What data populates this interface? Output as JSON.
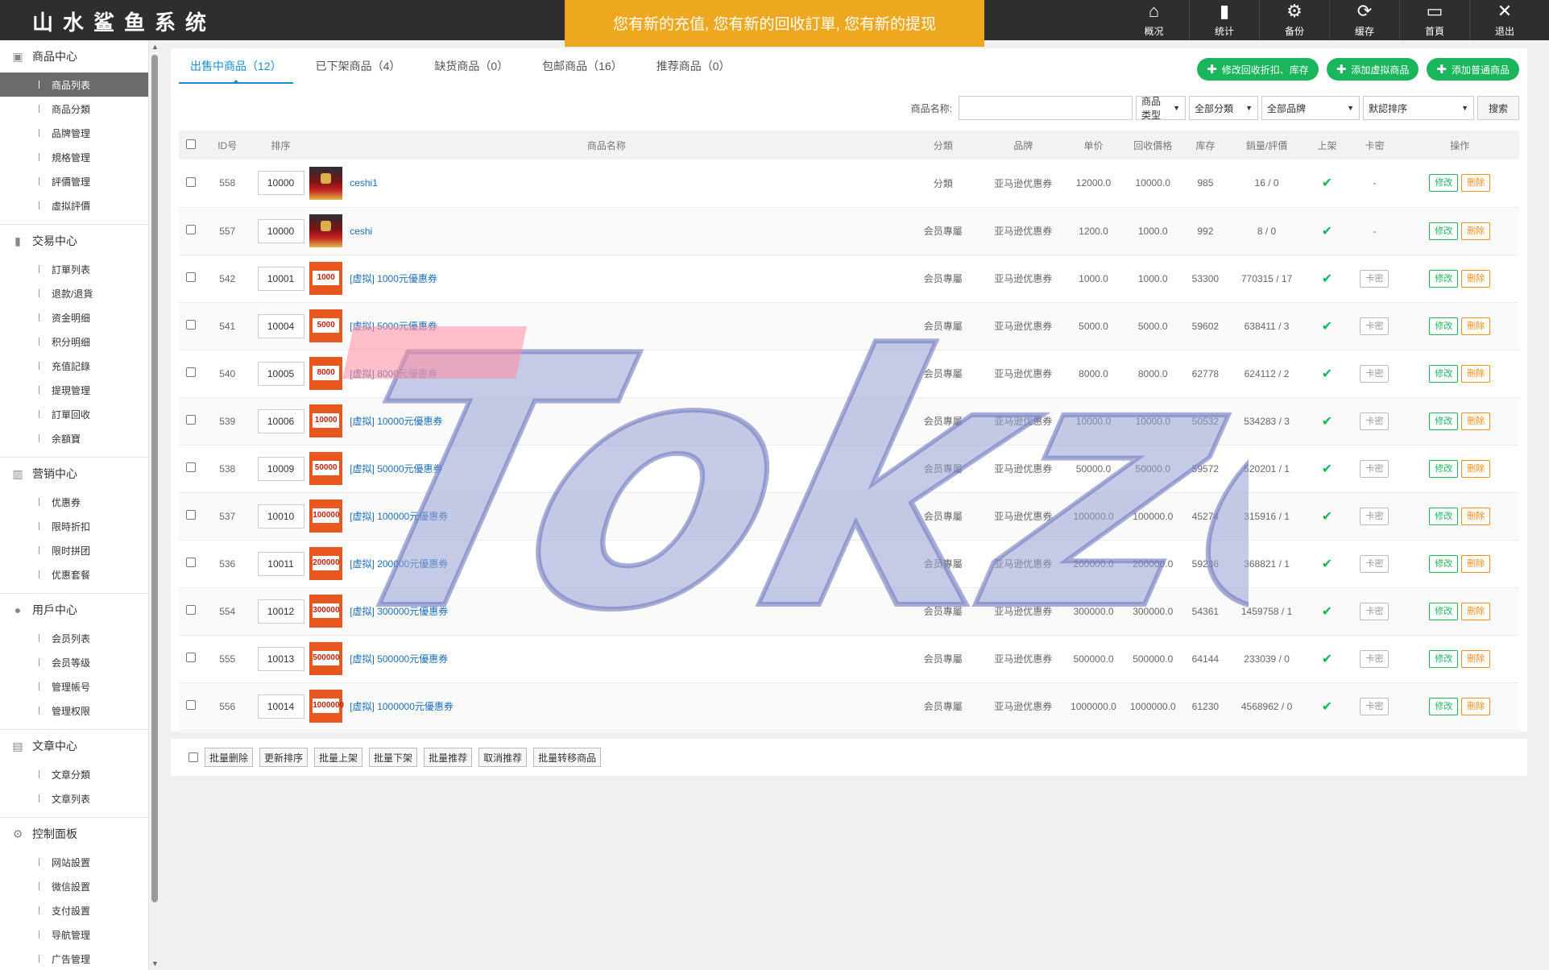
{
  "app": {
    "title": "山水鲨鱼系统"
  },
  "notice": {
    "text": "您有新的充值, 您有新的回收訂單, 您有新的提现"
  },
  "topnav": [
    {
      "label": "概况",
      "icon": "home-icon",
      "glyph": "⌂"
    },
    {
      "label": "统计",
      "icon": "bar-chart-icon",
      "glyph": "▮"
    },
    {
      "label": "备份",
      "icon": "gear-icon",
      "glyph": "⚙"
    },
    {
      "label": "缓存",
      "icon": "refresh-icon",
      "glyph": "⟳"
    },
    {
      "label": "首頁",
      "icon": "monitor-icon",
      "glyph": "▭"
    },
    {
      "label": "退出",
      "icon": "close-icon",
      "glyph": "✕"
    }
  ],
  "sidebar": [
    {
      "title": "商品中心",
      "icon": "box-icon",
      "glyph": "▣",
      "items": [
        "商品列表",
        "商品分類",
        "品牌管理",
        "規格管理",
        "評價管理",
        "虛拟評價"
      ]
    },
    {
      "title": "交易中心",
      "icon": "chart-icon",
      "glyph": "▮",
      "items": [
        "訂單列表",
        "退款/退貨",
        "资金明细",
        "积分明细",
        "充值記錄",
        "提現管理",
        "訂單回收",
        "余額寶"
      ]
    },
    {
      "title": "营销中心",
      "icon": "marketing-icon",
      "glyph": "▥",
      "items": [
        "优惠券",
        "限時折扣",
        "限时拼团",
        "优惠套餐"
      ]
    },
    {
      "title": "用戶中心",
      "icon": "user-icon",
      "glyph": "●",
      "items": [
        "会员列表",
        "会员等级",
        "管理帳号",
        "管理权限"
      ]
    },
    {
      "title": "文章中心",
      "icon": "document-icon",
      "glyph": "▤",
      "items": [
        "文章分類",
        "文章列表"
      ]
    },
    {
      "title": "控制面板",
      "icon": "settings-icon",
      "glyph": "⚙",
      "items": [
        "网站設置",
        "微信設置",
        "支付設置",
        "导航管理",
        "广告管理"
      ]
    }
  ],
  "tabs": [
    "出售中商品（12）",
    "已下架商品（4）",
    "缺货商品（0）",
    "包邮商品（16）",
    "推荐商品（0）"
  ],
  "actions": [
    "修改回收折扣、库存",
    "添加虚拟商品",
    "添加普通商品"
  ],
  "search": {
    "label": "商品名称:",
    "type_select": "商品类型",
    "category_select": "全部分類",
    "brand_select": "全部品牌",
    "sort_select": "默認排序",
    "button": "搜索"
  },
  "table": {
    "headers": [
      "ID号",
      "排序",
      "商品名称",
      "分類",
      "品牌",
      "单价",
      "回收價格",
      "库存",
      "銷量/評價",
      "上架",
      "卡密",
      "操作"
    ],
    "rows": [
      {
        "id": "558",
        "sort": "10000",
        "name": "ceshi1",
        "thumb": "hero",
        "category": "分類",
        "brand": "亚马逊优惠券",
        "price": "12000.0",
        "recycle": "10000.0",
        "stock": "985",
        "sales": "16 / 0",
        "card": "-"
      },
      {
        "id": "557",
        "sort": "10000",
        "name": "ceshi",
        "thumb": "hero",
        "category": "会员專屬",
        "brand": "亚马逊优惠券",
        "price": "1200.0",
        "recycle": "1000.0",
        "stock": "992",
        "sales": "8 / 0",
        "card": "-"
      },
      {
        "id": "542",
        "sort": "10001",
        "name": "[虚拟] 1000元優惠券",
        "thumb": "1000",
        "category": "会员專屬",
        "brand": "亚马逊优惠券",
        "price": "1000.0",
        "recycle": "1000.0",
        "stock": "53300",
        "sales": "770315 / 17",
        "card": "卡密"
      },
      {
        "id": "541",
        "sort": "10004",
        "name": "[虚拟] 5000元優惠券",
        "thumb": "5000",
        "category": "会员專屬",
        "brand": "亚马逊优惠券",
        "price": "5000.0",
        "recycle": "5000.0",
        "stock": "59602",
        "sales": "638411 / 3",
        "card": "卡密"
      },
      {
        "id": "540",
        "sort": "10005",
        "name": "[虚拟] 8000元優惠券",
        "thumb": "8000",
        "category": "会员專屬",
        "brand": "亚马逊优惠券",
        "price": "8000.0",
        "recycle": "8000.0",
        "stock": "62778",
        "sales": "624112 / 2",
        "card": "卡密"
      },
      {
        "id": "539",
        "sort": "10006",
        "name": "[虚拟] 10000元優惠券",
        "thumb": "10000",
        "category": "会员專屬",
        "brand": "亚马逊优惠券",
        "price": "10000.0",
        "recycle": "10000.0",
        "stock": "50532",
        "sales": "534283 / 3",
        "card": "卡密"
      },
      {
        "id": "538",
        "sort": "10009",
        "name": "[虚拟] 50000元優惠券",
        "thumb": "50000",
        "category": "会员專屬",
        "brand": "亚马逊优惠券",
        "price": "50000.0",
        "recycle": "50000.0",
        "stock": "59572",
        "sales": "520201 / 1",
        "card": "卡密"
      },
      {
        "id": "537",
        "sort": "10010",
        "name": "[虚拟] 100000元優惠券",
        "thumb": "100000",
        "category": "会员專屬",
        "brand": "亚马逊优惠券",
        "price": "100000.0",
        "recycle": "100000.0",
        "stock": "45274",
        "sales": "315916 / 1",
        "card": "卡密"
      },
      {
        "id": "536",
        "sort": "10011",
        "name": "[虚拟] 200000元優惠券",
        "thumb": "200000",
        "category": "会员專屬",
        "brand": "亚马逊优惠券",
        "price": "200000.0",
        "recycle": "200000.0",
        "stock": "59236",
        "sales": "368821 / 1",
        "card": "卡密"
      },
      {
        "id": "554",
        "sort": "10012",
        "name": "[虚拟] 300000元優惠券",
        "thumb": "300000",
        "category": "会员專屬",
        "brand": "亚马逊优惠券",
        "price": "300000.0",
        "recycle": "300000.0",
        "stock": "54361",
        "sales": "1459758 / 1",
        "card": "卡密"
      },
      {
        "id": "555",
        "sort": "10013",
        "name": "[虚拟] 500000元優惠券",
        "thumb": "500000",
        "category": "会员專屬",
        "brand": "亚马逊优惠券",
        "price": "500000.0",
        "recycle": "500000.0",
        "stock": "64144",
        "sales": "233039 / 0",
        "card": "卡密"
      },
      {
        "id": "556",
        "sort": "10014",
        "name": "[虚拟] 1000000元優惠券",
        "thumb": "1000000",
        "category": "会员專屬",
        "brand": "亚马逊优惠券",
        "price": "1000000.0",
        "recycle": "1000000.0",
        "stock": "61230",
        "sales": "4568962 / 0",
        "card": "卡密"
      }
    ],
    "edit_label": "修改",
    "delete_label": "刪除",
    "listed_mark": "✔"
  },
  "bulk_actions": [
    "批量删除",
    "更新排序",
    "批量上架",
    "批量下架",
    "批量推荐",
    "取消推荐",
    "批量转移商品"
  ],
  "watermark": {
    "text": "Tokzon"
  }
}
